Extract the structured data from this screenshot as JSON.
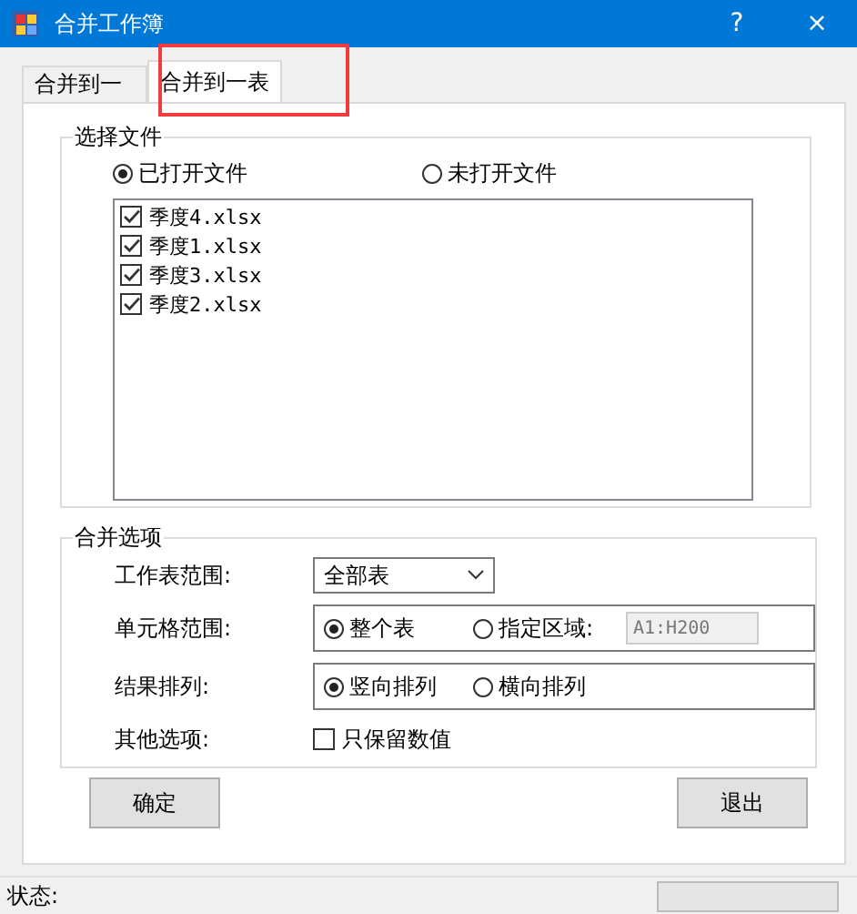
{
  "window": {
    "title": "合并工作簿",
    "help": "?",
    "close": "×"
  },
  "tabs": [
    {
      "label": "合并到一",
      "selected": false
    },
    {
      "label": "合并到一表",
      "selected": true
    }
  ],
  "file_group": {
    "title": "选择文件",
    "sources": [
      {
        "label": "已打开文件",
        "selected": true
      },
      {
        "label": "未打开文件",
        "selected": false
      }
    ],
    "files": [
      {
        "name": "季度4.xlsx",
        "checked": true
      },
      {
        "name": "季度1.xlsx",
        "checked": true
      },
      {
        "name": "季度3.xlsx",
        "checked": true
      },
      {
        "name": "季度2.xlsx",
        "checked": true
      }
    ]
  },
  "options_group": {
    "title": "合并选项",
    "sheet_range": {
      "label": "工作表范围:",
      "value": "全部表"
    },
    "cell_range": {
      "label": "单元格范围:",
      "options": [
        {
          "label": "整个表",
          "selected": true
        },
        {
          "label": "指定区域:",
          "selected": false
        }
      ],
      "area": "A1:H200"
    },
    "result_order": {
      "label": "结果排列:",
      "options": [
        {
          "label": "竖向排列",
          "selected": true
        },
        {
          "label": "横向排列",
          "selected": false
        }
      ]
    },
    "other": {
      "label": "其他选项:",
      "checkbox": {
        "label": "只保留数值",
        "checked": false
      }
    }
  },
  "buttons": [
    {
      "label": "确定"
    },
    {
      "label": "退出"
    }
  ],
  "status_bar": {
    "label": "状态:"
  }
}
